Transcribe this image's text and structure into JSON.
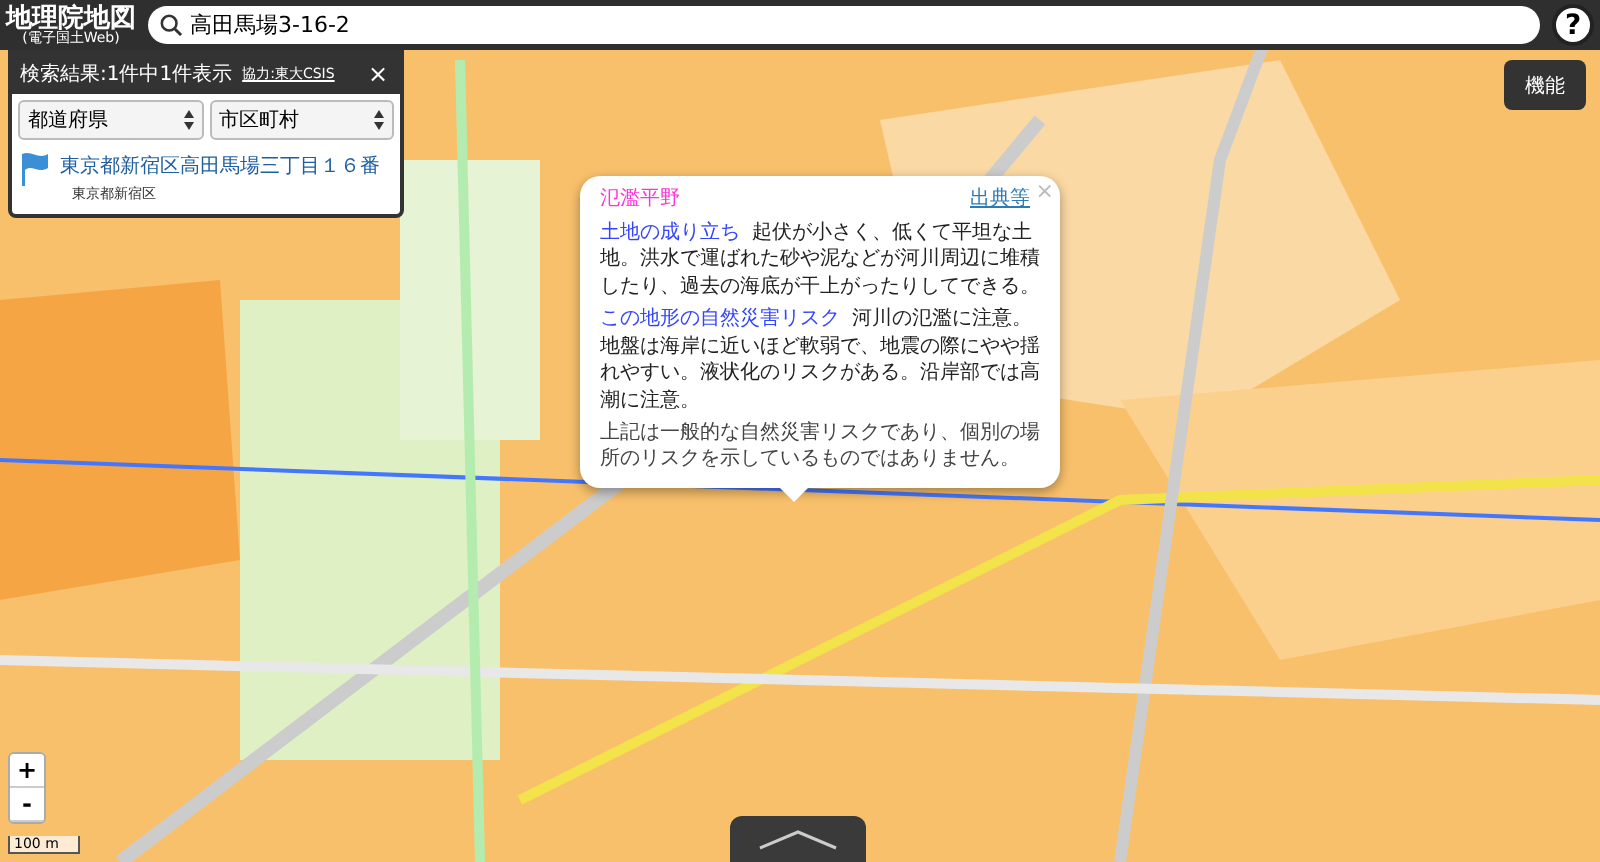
{
  "header": {
    "title": "地理院地図",
    "subtitle": "(電子国土Web)",
    "search_value": "高田馬場3-16-2",
    "help": "?"
  },
  "search_results": {
    "title": "検索結果:1件中1件表示",
    "credit": "協力:東大CSIS",
    "close": "×",
    "filters": [
      "都道府県",
      "市区町村"
    ],
    "results": [
      {
        "name": "東京都新宿区高田馬場三丁目１６番",
        "area": "東京都新宿区"
      }
    ]
  },
  "popup": {
    "title": "氾濫平野",
    "source_link": "出典等",
    "close": "×",
    "sections": [
      {
        "heading": "土地の成り立ち",
        "body": "起伏が小さく、低くて平坦な土地。洪水で運ばれた砂や泥などが河川周辺に堆積したり、過去の海底が干上がったりしてできる。"
      },
      {
        "heading": "この地形の自然災害リスク",
        "body": "河川の氾濫に注意。地盤は海岸に近いほど軟弱で、地震の際にやや揺れやすい。液状化のリスクがある。沿岸部では高潮に注意。"
      }
    ],
    "note": "上記は一般的な自然災害リスクであり、個別の場所のリスクを示しているものではありません。"
  },
  "function_button": "機能",
  "zoom": [
    "+",
    "-"
  ],
  "scale": "100 m"
}
